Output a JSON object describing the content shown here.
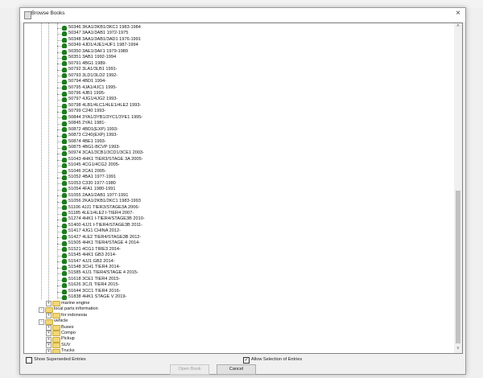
{
  "window": {
    "title": "Browse Books"
  },
  "books": [
    "50346 3KA1/3KB1/3KC1 1983-1984",
    "50347 3AA1/3AB1 1972-1975",
    "50348 3AA1/3AB1/3AD1 1976-1991",
    "50349 4JD1/4JE1/4JF1 1987-1994",
    "50350 3AE1/3AF1 1979-1989",
    "50351 3AB1 1992-1994",
    "50791 4BG1 1989-",
    "50792 3LA1/3LB1 1991-",
    "50793 3LD1/3LD2 1992-",
    "50794 4BD1 1994-",
    "50795 4JA1/4JC1 1995-",
    "50796 4JB1 1995-",
    "50797 4JG1/4JG2 1993-",
    "50798 4LB1/4LC1/4LE1/4LE2 1993-",
    "50799 C240 1993-",
    "50844 3YA1/3YB1/3YC1/3YE1 1995-",
    "50845 2YA1 1981-",
    "50872 4BD1(EXP) 1993-",
    "50873 C240(EXP) 1993-",
    "50874 4BE1 1993-",
    "50875 4BG1-BCVP 1993-",
    "50974 3CA1/3CB1/3CD1/3CE1 2003-",
    "51043 4HK1 TIER3/STAGE 3A 2005-",
    "51045 4CG1/4CG2 2005-",
    "51046 2CA1 2005-",
    "51052 4BA1 1977-1991",
    "51053 C330 1977-1980",
    "51054 4FA1 1980-1991",
    "51055 2AA1/2AB1 1977-1991",
    "51056 2KA1/2KB1/2KC1 1983-1993",
    "51106 4JJ1 TIER3/STAGE3A 2006-",
    "51185 4LE1/4LE2 I-TIER4 2007-",
    "51274 4HK1 I-TIER4/STAGE3B 2010-",
    "51400 4JJ1 I-TIER4/STAGE3B 2011-",
    "51417 4JG1 CHINA 2012-",
    "51427 4LE2 TIER4/STAGE3B 2012-",
    "51505 4HK1 TIER4/STAGE 4 2014-",
    "51521 4CG1 TIRE3 2014-",
    "51545 4HK1 GB3 2014-",
    "51547 4JJ1 GB3 2014-",
    "51548 3CH1 TIER4 2014-",
    "51585 4JJ1 TIER4/STAGE 4 2015-",
    "51618 3CE1 TIER4 2015-",
    "51626 3CJ1 TIER4 2015-",
    "51644 3CC1 TIER4 2016-",
    "51838 4HK1 STAGE V 2019-"
  ],
  "folders": [
    {
      "label": "marine engine",
      "level": 1,
      "expander": "+"
    },
    {
      "label": "local parts information",
      "level": 0,
      "expander": "-"
    },
    {
      "label": "for indonesia",
      "level": 1,
      "expander": "+"
    },
    {
      "label": "vehicle",
      "level": 0,
      "expander": "-"
    },
    {
      "label": "Buses",
      "level": 1,
      "expander": "+"
    },
    {
      "label": "Compo",
      "level": 1,
      "expander": "+"
    },
    {
      "label": "Pickup",
      "level": 1,
      "expander": "+"
    },
    {
      "label": "SUV",
      "level": 1,
      "expander": "+"
    },
    {
      "label": "Trucks",
      "level": 1,
      "expander": "+"
    }
  ],
  "footer": {
    "show_superseded": "Show Superseded Entries",
    "show_superseded_checked": false,
    "allow_selection": "Allow Selection of Entries",
    "allow_selection_checked": true,
    "open_book": "Open Book",
    "cancel": "Cancel"
  },
  "icons": {
    "close": "×",
    "scroll_up": "˄",
    "scroll_down": "˅",
    "check": "✓"
  }
}
